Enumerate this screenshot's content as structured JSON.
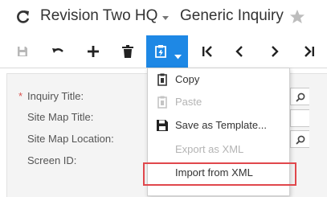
{
  "header": {
    "company": "Revision Two HQ",
    "screen_title": "Generic Inquiry",
    "icons": [
      "refresh-icon",
      "chevron-down-icon",
      "star-icon"
    ]
  },
  "toolbar": {
    "buttons": [
      {
        "name": "save",
        "icon": "floppy-disk-icon",
        "enabled": false
      },
      {
        "name": "undo",
        "icon": "undo-icon",
        "enabled": true
      },
      {
        "name": "add",
        "icon": "plus-icon",
        "enabled": true
      },
      {
        "name": "delete",
        "icon": "trash-icon",
        "enabled": true
      },
      {
        "name": "clipboard",
        "icon": "clipboard-icon",
        "enabled": true,
        "active": true
      },
      {
        "name": "first",
        "icon": "first-page-icon",
        "enabled": true
      },
      {
        "name": "previous",
        "icon": "chevron-left-icon",
        "enabled": true
      },
      {
        "name": "next",
        "icon": "chevron-right-icon",
        "enabled": true
      },
      {
        "name": "last",
        "icon": "last-page-icon",
        "enabled": true
      }
    ],
    "accent_color": "#1e88e5"
  },
  "form": {
    "fields": [
      {
        "label": "Inquiry Title:",
        "required": true
      },
      {
        "label": "Site Map Title:",
        "required": false
      },
      {
        "label": "Site Map Location:",
        "required": false
      },
      {
        "label": "Screen ID:",
        "required": false
      }
    ],
    "required_marker": "*"
  },
  "menu": {
    "items": [
      {
        "label": "Copy",
        "enabled": true,
        "icon": "copy-icon"
      },
      {
        "label": "Paste",
        "enabled": false,
        "icon": "paste-icon"
      },
      {
        "label": "Save as Template...",
        "enabled": true,
        "icon": "save-template-icon"
      },
      {
        "label": "Export as XML",
        "enabled": false,
        "icon": ""
      },
      {
        "label": "Import from XML",
        "enabled": true,
        "icon": "",
        "highlighted": true
      }
    ],
    "highlight_color": "#e0474c"
  }
}
